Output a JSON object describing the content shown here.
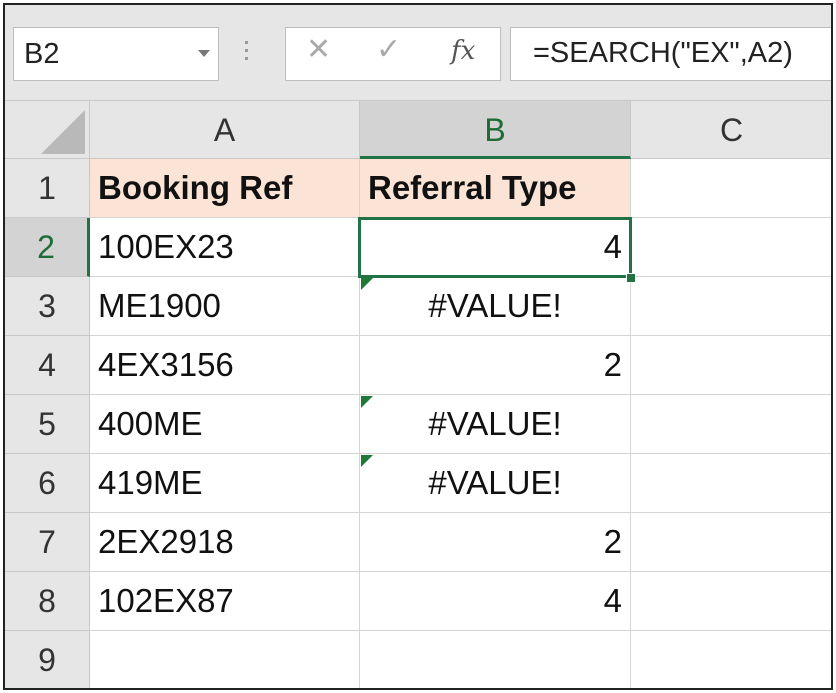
{
  "name_box": {
    "value": "B2"
  },
  "formula_bar": {
    "cancel_icon": "✕",
    "enter_icon": "✓",
    "fx_label": "fx",
    "value": "=SEARCH(\"EX\",A2)"
  },
  "columns": [
    "A",
    "B",
    "C"
  ],
  "active_column": "B",
  "rows": [
    "1",
    "2",
    "3",
    "4",
    "5",
    "6",
    "7",
    "8",
    "9"
  ],
  "active_row": "2",
  "header": {
    "a": "Booking Ref",
    "b": "Referral Type"
  },
  "data": [
    {
      "a": "100EX23",
      "b": "4"
    },
    {
      "a": "ME1900",
      "b": "#VALUE!"
    },
    {
      "a": "4EX3156",
      "b": "2"
    },
    {
      "a": "400ME",
      "b": "#VALUE!"
    },
    {
      "a": "419ME",
      "b": "#VALUE!"
    },
    {
      "a": "2EX2918",
      "b": "2"
    },
    {
      "a": "102EX87",
      "b": "4"
    }
  ],
  "colors": {
    "header_fill": "#fbe3d6",
    "selection": "#217346",
    "error_flag": "#1f7a3a"
  }
}
